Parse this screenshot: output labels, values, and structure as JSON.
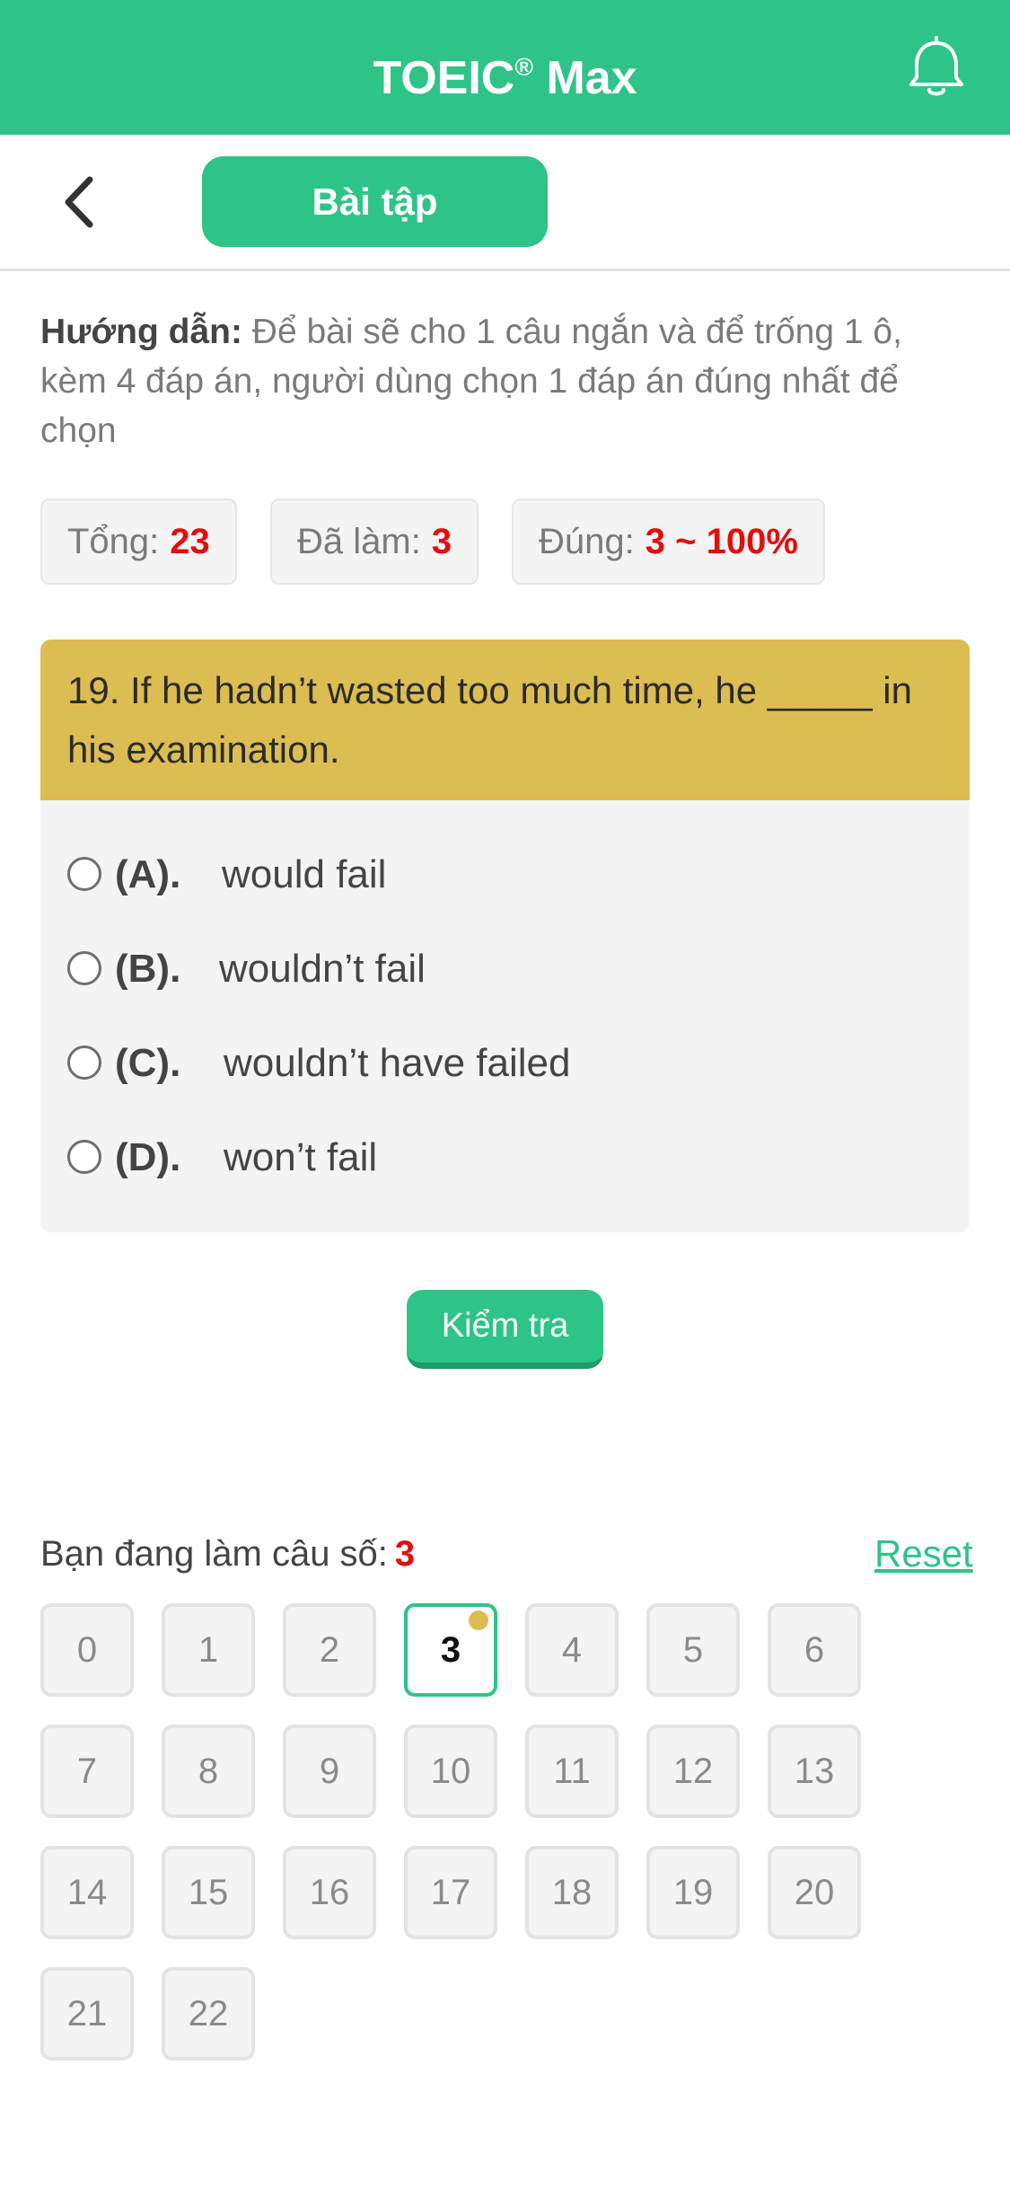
{
  "header": {
    "title": "TOEIC",
    "title_sup": "®",
    "title_suffix": " Max"
  },
  "subnav": {
    "tab_label": "Bài tập"
  },
  "instructions": {
    "label": "Hướng dẫn:",
    "text": " Để bài sẽ cho 1 câu ngắn và để trống 1 ô, kèm 4 đáp án, người dùng chọn 1 đáp án đúng nhất để chọn"
  },
  "stats": {
    "total_label": "Tổng:",
    "total_value": "23",
    "done_label": "Đã làm:",
    "done_value": "3",
    "correct_label": "Đúng:",
    "correct_value": "3 ~ 100%"
  },
  "question": {
    "text": "19. If he hadn’t wasted too much time, he _____ in his examination.",
    "options": [
      {
        "letter": "(A).",
        "text": "would fail"
      },
      {
        "letter": "(B).",
        "text": "wouldn’t fail"
      },
      {
        "letter": "(C).",
        "text": "wouldn’t have failed"
      },
      {
        "letter": "(D).",
        "text": "won’t fail"
      }
    ]
  },
  "check_button": "Kiểm tra",
  "progress": {
    "label": "Bạn đang làm câu số:",
    "current": "3",
    "reset_label": "Reset"
  },
  "question_numbers": [
    "0",
    "1",
    "2",
    "3",
    "4",
    "5",
    "6",
    "7",
    "8",
    "9",
    "10",
    "11",
    "12",
    "13",
    "14",
    "15",
    "16",
    "17",
    "18",
    "19",
    "20",
    "21",
    "22"
  ],
  "colors": {
    "primary": "#2ec487",
    "question_header": "#dcbd51",
    "highlight": "#e30e0e"
  }
}
